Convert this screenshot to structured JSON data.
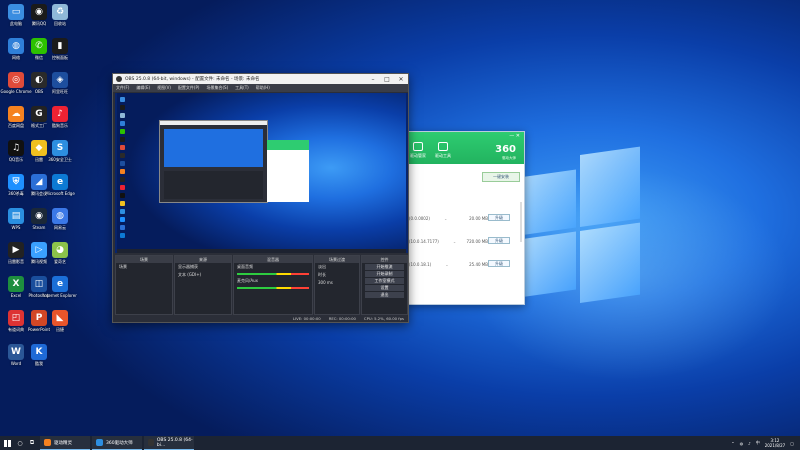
{
  "desktop": {
    "icons": [
      {
        "label": "此电脑",
        "color": "#3a8de0",
        "glyph": "▭",
        "icon": "computer-icon"
      },
      {
        "label": "腾讯QQ",
        "color": "#1a1a1a",
        "glyph": "◉",
        "icon": "qq-icon"
      },
      {
        "label": "回收站",
        "color": "#8fb8d8",
        "glyph": "♻",
        "icon": "recycle-bin-icon"
      },
      {
        "label": "网络",
        "color": "#2f7fd8",
        "glyph": "◍",
        "icon": "network-icon"
      },
      {
        "label": "微信",
        "color": "#2dc100",
        "glyph": "✆",
        "icon": "wechat-icon"
      },
      {
        "label": "控制面板",
        "color": "#1b1b1b",
        "glyph": "▮",
        "icon": "control-panel-icon"
      },
      {
        "label": "Google Chrome",
        "color": "#e04b3a",
        "glyph": "◎",
        "icon": "chrome-icon"
      },
      {
        "label": "OBS",
        "color": "#2a2a2a",
        "glyph": "◐",
        "icon": "obs-icon"
      },
      {
        "label": "阿里旺旺",
        "color": "#1d4e9e",
        "glyph": "◈",
        "icon": "download-icon"
      },
      {
        "label": "百度网盘",
        "color": "#f58220",
        "glyph": "☁",
        "icon": "cloud-icon"
      },
      {
        "label": "格式工厂",
        "color": "#222",
        "glyph": "G",
        "icon": "format-factory-icon"
      },
      {
        "label": "酷狗音乐",
        "color": "#e23",
        "glyph": "♪",
        "icon": "music-icon"
      },
      {
        "label": "QQ音乐",
        "color": "#111",
        "glyph": "♫",
        "icon": "qq-music-icon"
      },
      {
        "label": "迅雷",
        "color": "#f0c020",
        "glyph": "◆",
        "icon": "xunlei-icon"
      },
      {
        "label": "360安全卫士",
        "color": "#2d8ee0",
        "glyph": "S",
        "icon": "security-icon"
      },
      {
        "label": "360杀毒",
        "color": "#1e90ff",
        "glyph": "⛨",
        "icon": "shield-icon"
      },
      {
        "label": "腾讯会议",
        "color": "#2b6fd6",
        "glyph": "◢",
        "icon": "meeting-icon"
      },
      {
        "label": "Microsoft Edge",
        "color": "#0d7ad4",
        "glyph": "e",
        "icon": "edge-icon"
      },
      {
        "label": "WPS",
        "color": "#2a8fe0",
        "glyph": "▤",
        "icon": "wps-icon"
      },
      {
        "label": "Steam",
        "color": "#1b2838",
        "glyph": "◉",
        "icon": "steam-icon"
      },
      {
        "label": "网易云",
        "color": "#3b78e7",
        "glyph": "◍",
        "icon": "netease-icon"
      },
      {
        "label": "迅雷影音",
        "color": "#222",
        "glyph": "▶",
        "icon": "player-icon"
      },
      {
        "label": "腾讯视频",
        "color": "#3aa0ff",
        "glyph": "▷",
        "icon": "video-icon"
      },
      {
        "label": "爱奇艺",
        "color": "#8bc34a",
        "glyph": "◕",
        "icon": "iqiyi-icon"
      },
      {
        "label": "Excel",
        "color": "#1e8e3e",
        "glyph": "X",
        "icon": "excel-icon"
      },
      {
        "label": "Photoshop",
        "color": "#1a4e9c",
        "glyph": "◫",
        "icon": "photoshop-icon"
      },
      {
        "label": "Internet Explorer",
        "color": "#1b6fd8",
        "glyph": "e",
        "icon": "ie-icon"
      },
      {
        "label": "有道词典",
        "color": "#d33",
        "glyph": "◰",
        "icon": "dictionary-icon"
      },
      {
        "label": "PowerPoint",
        "color": "#d24726",
        "glyph": "P",
        "icon": "powerpoint-icon"
      },
      {
        "label": "迅捷",
        "color": "#e8552b",
        "glyph": "◣",
        "icon": "app-icon"
      },
      {
        "label": "Word",
        "color": "#2b5797",
        "glyph": "W",
        "icon": "word-icon"
      },
      {
        "label": "酷我",
        "color": "#1f6ad6",
        "glyph": "K",
        "icon": "kuwo-icon"
      }
    ]
  },
  "obs": {
    "title": "OBS 25.0.8 (64-bit, windows) - 配置文件: 未命名 - 场景: 未命名",
    "menu": [
      "文件(F)",
      "编辑(E)",
      "视图(V)",
      "配置文件(P)",
      "场景集合(S)",
      "工具(T)",
      "帮助(H)"
    ],
    "docks": {
      "scenes": {
        "title": "场景",
        "items": [
          "场景"
        ]
      },
      "sources": {
        "title": "来源",
        "items": [
          "显示器捕获",
          "文本 (GDI+)"
        ]
      },
      "mixer": {
        "title": "混音器",
        "items": [
          "桌面音频",
          "麦克风/Aux"
        ]
      },
      "transitions": {
        "title": "场景过渡",
        "items": [
          "淡出",
          "时长",
          "300 ms"
        ]
      },
      "controls": {
        "title": "控件",
        "items": [
          "开始推流",
          "开始录制",
          "工作室模式",
          "设置",
          "退出"
        ]
      }
    },
    "status": [
      "LIVE: 00:00:00",
      "REC: 00:00:00",
      "CPU: 5.2%, 60.00 fps"
    ]
  },
  "w360": {
    "logo": "360",
    "sub": "驱动大师",
    "tabs": [
      "驱动管家",
      "驱动工具"
    ],
    "top_button": "一键安装",
    "rows": [
      {
        "name": "(0.0.0002)",
        "size": "20.00 MB",
        "btn": "升级"
      },
      {
        "name": "(10.0.14.7177)",
        "size": "720.00 MB",
        "btn": "升级"
      },
      {
        "name": "(10.0.18.1)",
        "size": "25.40 MB",
        "btn": "升级"
      }
    ]
  },
  "taskbar": {
    "apps": [
      {
        "label": "驱动精灵",
        "color": "#f58220"
      },
      {
        "label": "360驱动大师",
        "color": "#2d8ee0"
      },
      {
        "label": "OBS 25.0.8 (64-bi...",
        "color": "#333"
      }
    ],
    "tray_lang": "中",
    "time": "3:12",
    "date": "2021/8/27"
  }
}
